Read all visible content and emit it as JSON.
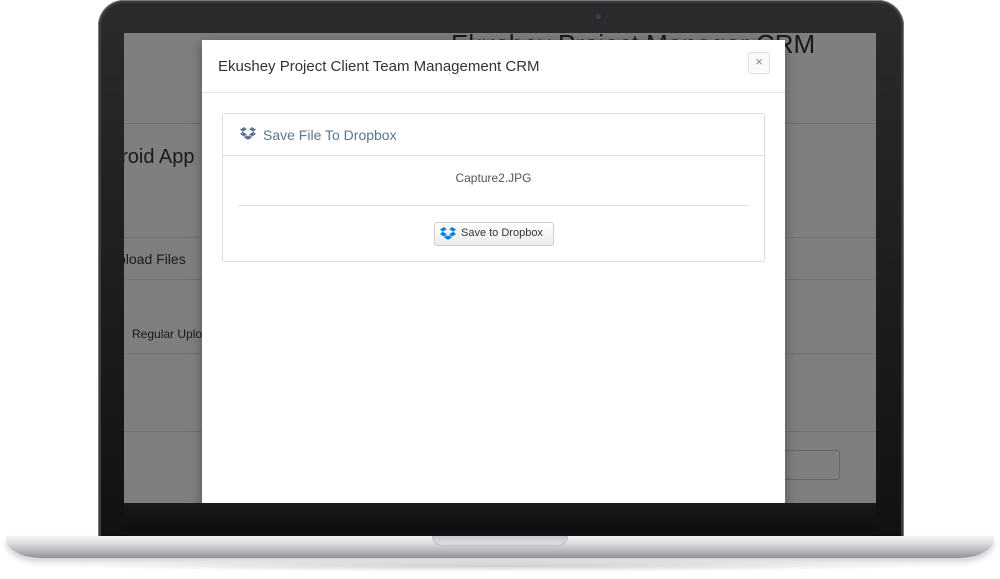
{
  "background_app": {
    "app_title": "Ekushey Project Manager CRM",
    "project_title": "droid App",
    "upload_files_label": "pload Files",
    "regular_upload_label": "Regular Uplo"
  },
  "modal": {
    "title": "Ekushey Project Client Team Management CRM",
    "close_label": "×",
    "panel": {
      "heading": "Save File To Dropbox",
      "heading_icon": "dropbox-icon",
      "file_name": "Capture2.JPG",
      "button_label": "Save to Dropbox",
      "button_icon": "dropbox-icon"
    }
  },
  "colors": {
    "dropbox_blue": "#007ee5",
    "heading_text": "#5b7693",
    "overlay": "rgba(0,0,0,0.5)"
  }
}
